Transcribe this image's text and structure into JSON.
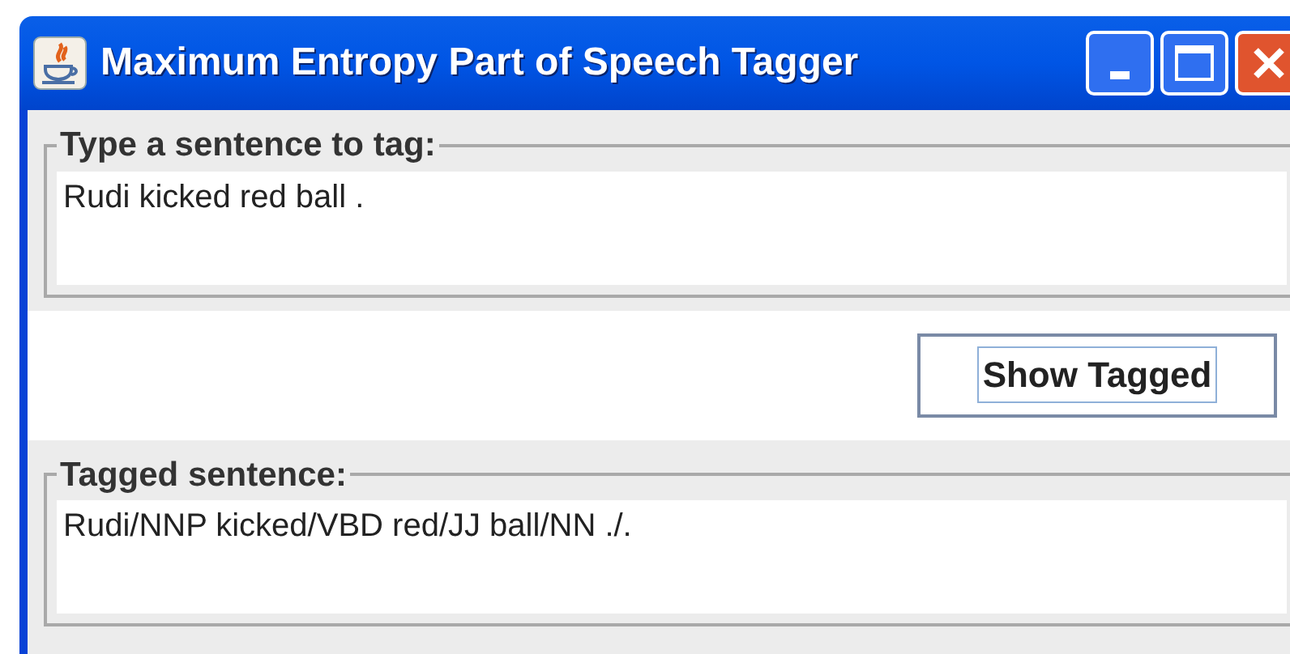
{
  "window": {
    "title": "Maximum Entropy Part of Speech Tagger"
  },
  "input_group": {
    "label": "Type a sentence to tag:",
    "value": "Rudi kicked red ball ."
  },
  "button": {
    "label": "Show Tagged",
    "focused": true
  },
  "output_group": {
    "label": "Tagged sentence:",
    "value": "Rudi/NNP kicked/VBD red/JJ ball/NN ./."
  }
}
